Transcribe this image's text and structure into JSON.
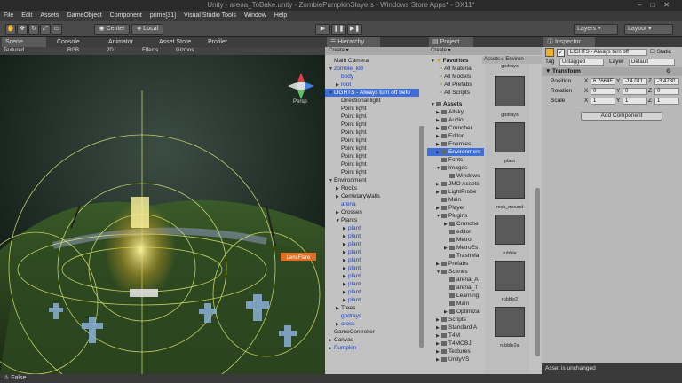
{
  "window": {
    "title": "Unity - arena_ToBake.unity - ZombiePumpkinSlayers - Windows Store Apps* - DX11*"
  },
  "menu": [
    "File",
    "Edit",
    "Assets",
    "GameObject",
    "Component",
    "prime[31]",
    "Visual Studio Tools",
    "Window",
    "Help"
  ],
  "toolbar": {
    "center_label": "Center",
    "local_label": "Local",
    "layers_label": "Layers",
    "layout_label": "Layout"
  },
  "scene": {
    "tabs": [
      "Scene",
      "Console",
      "Animator",
      "Asset Store",
      "Profiler"
    ],
    "options": [
      "Textured",
      "RGB",
      "2D",
      "Effects",
      "Gizmos"
    ],
    "gizmo_label": "Persp",
    "light_tag": "LensFlare"
  },
  "hierarchy": {
    "title": "Hierarchy",
    "create": "Create",
    "items": [
      {
        "label": "Main Camera",
        "indent": 0,
        "arrow": "",
        "style": ""
      },
      {
        "label": "zombie_kid",
        "indent": 0,
        "arrow": "▼",
        "style": "blue"
      },
      {
        "label": "body",
        "indent": 1,
        "arrow": "",
        "style": "blue"
      },
      {
        "label": "root",
        "indent": 1,
        "arrow": "▶",
        "style": "blue"
      },
      {
        "label": "LIGHTS - Always turn off befo",
        "indent": 0,
        "arrow": "▼",
        "style": "sel"
      },
      {
        "label": "Directional light",
        "indent": 1,
        "arrow": "",
        "style": ""
      },
      {
        "label": "Point light",
        "indent": 1,
        "arrow": "",
        "style": ""
      },
      {
        "label": "Point light",
        "indent": 1,
        "arrow": "",
        "style": ""
      },
      {
        "label": "Point light",
        "indent": 1,
        "arrow": "",
        "style": ""
      },
      {
        "label": "Point light",
        "indent": 1,
        "arrow": "",
        "style": ""
      },
      {
        "label": "Point light",
        "indent": 1,
        "arrow": "",
        "style": ""
      },
      {
        "label": "Point light",
        "indent": 1,
        "arrow": "",
        "style": ""
      },
      {
        "label": "Point light",
        "indent": 1,
        "arrow": "",
        "style": ""
      },
      {
        "label": "Point light",
        "indent": 1,
        "arrow": "",
        "style": ""
      },
      {
        "label": "Point light",
        "indent": 1,
        "arrow": "",
        "style": ""
      },
      {
        "label": "Environment",
        "indent": 0,
        "arrow": "▼",
        "style": ""
      },
      {
        "label": "Rocks",
        "indent": 1,
        "arrow": "▶",
        "style": ""
      },
      {
        "label": "CemetaryWalls",
        "indent": 1,
        "arrow": "▶",
        "style": ""
      },
      {
        "label": "arena",
        "indent": 1,
        "arrow": "",
        "style": "blue"
      },
      {
        "label": "Crosses",
        "indent": 1,
        "arrow": "▶",
        "style": ""
      },
      {
        "label": "Plants",
        "indent": 1,
        "arrow": "▼",
        "style": ""
      },
      {
        "label": "plant",
        "indent": 2,
        "arrow": "▶",
        "style": "blue"
      },
      {
        "label": "plant",
        "indent": 2,
        "arrow": "▶",
        "style": "blue"
      },
      {
        "label": "plant",
        "indent": 2,
        "arrow": "▶",
        "style": "blue"
      },
      {
        "label": "plant",
        "indent": 2,
        "arrow": "▶",
        "style": "blue"
      },
      {
        "label": "plant",
        "indent": 2,
        "arrow": "▶",
        "style": "blue"
      },
      {
        "label": "plant",
        "indent": 2,
        "arrow": "▶",
        "style": "blue"
      },
      {
        "label": "plant",
        "indent": 2,
        "arrow": "▶",
        "style": "blue"
      },
      {
        "label": "plant",
        "indent": 2,
        "arrow": "▶",
        "style": "blue"
      },
      {
        "label": "plant",
        "indent": 2,
        "arrow": "▶",
        "style": "blue"
      },
      {
        "label": "plant",
        "indent": 2,
        "arrow": "▶",
        "style": "blue"
      },
      {
        "label": "Trees",
        "indent": 1,
        "arrow": "▶",
        "style": ""
      },
      {
        "label": "godrays",
        "indent": 1,
        "arrow": "",
        "style": "blue"
      },
      {
        "label": "cross",
        "indent": 1,
        "arrow": "▶",
        "style": "blue"
      },
      {
        "label": "GameController",
        "indent": 0,
        "arrow": "",
        "style": ""
      },
      {
        "label": "Canvas",
        "indent": 0,
        "arrow": "▶",
        "style": ""
      },
      {
        "label": "Pumpkin",
        "indent": 0,
        "arrow": "▶",
        "style": "blue"
      }
    ]
  },
  "project": {
    "title": "Project",
    "create": "Create",
    "breadcrumb": "Assets ▸ Environ",
    "favorites_label": "Favorites",
    "favorites": [
      "All Material",
      "All Models",
      "All Prefabs",
      "All Scripts"
    ],
    "assets_label": "Assets",
    "tree": [
      {
        "label": "Allsky",
        "indent": 0,
        "arrow": "▶"
      },
      {
        "label": "Audio",
        "indent": 0,
        "arrow": "▶"
      },
      {
        "label": "Cruncher",
        "indent": 0,
        "arrow": "▶"
      },
      {
        "label": "Editor",
        "indent": 0,
        "arrow": "▶"
      },
      {
        "label": "Enemies",
        "indent": 0,
        "arrow": "▶"
      },
      {
        "label": "Environment",
        "indent": 0,
        "arrow": "▶",
        "sel": true
      },
      {
        "label": "Fonts",
        "indent": 0,
        "arrow": ""
      },
      {
        "label": "Images",
        "indent": 0,
        "arrow": "▼"
      },
      {
        "label": "Windows",
        "indent": 1,
        "arrow": ""
      },
      {
        "label": "JMO Assets",
        "indent": 0,
        "arrow": "▶"
      },
      {
        "label": "LightProbe",
        "indent": 0,
        "arrow": "▶"
      },
      {
        "label": "Main",
        "indent": 0,
        "arrow": ""
      },
      {
        "label": "Player",
        "indent": 0,
        "arrow": "▶"
      },
      {
        "label": "Plugins",
        "indent": 0,
        "arrow": "▼"
      },
      {
        "label": "Crunche",
        "indent": 1,
        "arrow": "▶"
      },
      {
        "label": "editor",
        "indent": 1,
        "arrow": ""
      },
      {
        "label": "Metro",
        "indent": 1,
        "arrow": ""
      },
      {
        "label": "MetroEs",
        "indent": 1,
        "arrow": "▶"
      },
      {
        "label": "TrashMa",
        "indent": 1,
        "arrow": ""
      },
      {
        "label": "Prefabs",
        "indent": 0,
        "arrow": "▶"
      },
      {
        "label": "Scenes",
        "indent": 0,
        "arrow": "▼"
      },
      {
        "label": "arena_A",
        "indent": 1,
        "arrow": ""
      },
      {
        "label": "arena_T",
        "indent": 1,
        "arrow": ""
      },
      {
        "label": "Learning",
        "indent": 1,
        "arrow": ""
      },
      {
        "label": "Main",
        "indent": 1,
        "arrow": ""
      },
      {
        "label": "Optimiza",
        "indent": 1,
        "arrow": "▶"
      },
      {
        "label": "Scripts",
        "indent": 0,
        "arrow": "▶"
      },
      {
        "label": "Standard A",
        "indent": 0,
        "arrow": "▶"
      },
      {
        "label": "T4M",
        "indent": 0,
        "arrow": "▶"
      },
      {
        "label": "T4MOBJ",
        "indent": 0,
        "arrow": "▶"
      },
      {
        "label": "Textures",
        "indent": 0,
        "arrow": "▶"
      },
      {
        "label": "UnityVS",
        "indent": 0,
        "arrow": "▶"
      }
    ],
    "thumbs": [
      "godrays",
      "godrays",
      "plant",
      "rock_mound",
      "rubble",
      "rubble2",
      "rubble2a"
    ]
  },
  "inspector": {
    "title": "Inspector",
    "object_name": "LIGHTS - Always turn off",
    "static_label": "Static",
    "tag_label": "Tag",
    "tag_value": "Untagged",
    "layer_label": "Layer",
    "layer_value": "Default",
    "component": "Transform",
    "position": {
      "label": "Position",
      "x": "6.7664E",
      "y": "-14.011",
      "z": "-3.4780"
    },
    "rotation": {
      "label": "Rotation",
      "x": "0",
      "y": "0",
      "z": "0"
    },
    "scale": {
      "label": "Scale",
      "x": "1",
      "y": "1",
      "z": "1"
    },
    "axis_x": "X",
    "axis_y": "Y",
    "axis_z": "Z",
    "add_component": "Add Component",
    "footer": "Asset is unchanged"
  },
  "status": {
    "text": "False"
  }
}
